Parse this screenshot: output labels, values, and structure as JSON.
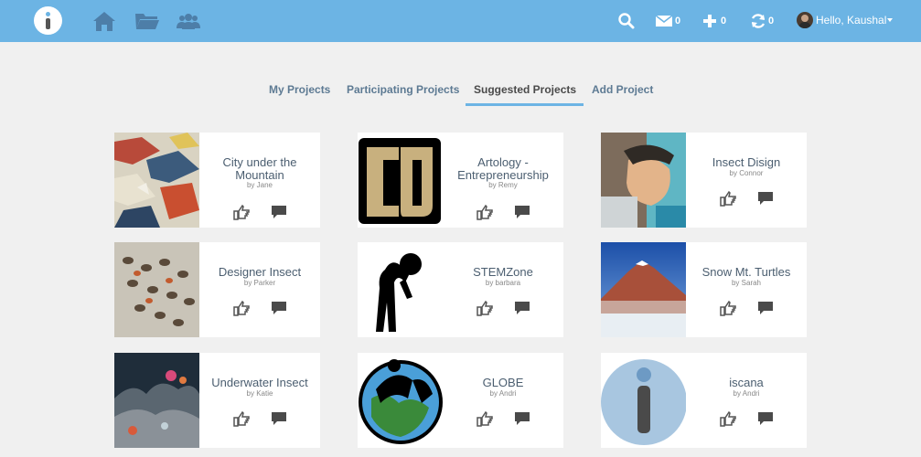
{
  "app": {
    "user_greeting": "Hello, Kaushal",
    "counts": {
      "messages": "0",
      "add": "0",
      "sync": "0"
    },
    "colors": {
      "topbar": "#6cb4e4",
      "background": "#f0f0f0",
      "title_text": "#4b5e70"
    }
  },
  "nav_icons": [
    "home-icon",
    "folder-icon",
    "people-icon"
  ],
  "tabs": [
    {
      "label": "My Projects",
      "active": false
    },
    {
      "label": "Participating Projects",
      "active": false
    },
    {
      "label": "Suggested Projects",
      "active": true
    },
    {
      "label": "Add Project",
      "active": false
    }
  ],
  "projects": [
    {
      "title": "City under the Mountain",
      "author": "by Jane"
    },
    {
      "title": "Artology - Entrepreneurship",
      "author": "by Remy"
    },
    {
      "title": "Insect Disign",
      "author": "by Connor"
    },
    {
      "title": "Designer Insect",
      "author": "by Parker"
    },
    {
      "title": "STEMZone",
      "author": "by barbara"
    },
    {
      "title": "Snow Mt. Turtles",
      "author": "by Sarah"
    },
    {
      "title": "Underwater Insect",
      "author": "by Katie"
    },
    {
      "title": "GLOBE",
      "author": "by Andri"
    },
    {
      "title": "iscana",
      "author": "by Andri"
    }
  ]
}
